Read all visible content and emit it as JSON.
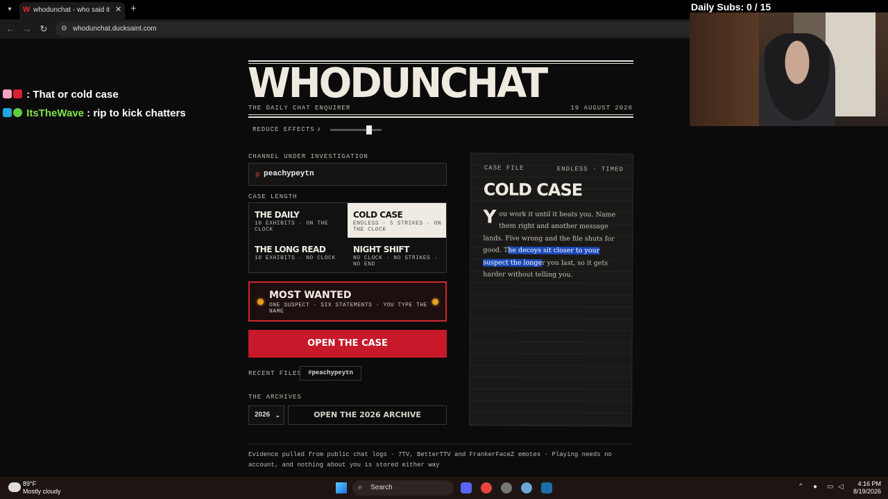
{
  "browser": {
    "tab_title": "whodunchat - who said it in your chat",
    "tab_favicon": "W",
    "url": "whodunchat.ducksaint.com"
  },
  "overlay": {
    "daily_subs": "Daily Subs: 0 / 15",
    "chat": [
      {
        "user": "",
        "user_color": "#8a2be2",
        "message": ": That or cold case"
      },
      {
        "user": "ItsTheWave",
        "user_color": "#7fe34a",
        "message": ": rip to kick chatters"
      }
    ]
  },
  "masthead": {
    "logo": "WHODUNCHAT",
    "tagline": "THE DAILY CHAT ENQUIRER",
    "date": "19 AUGUST 2026",
    "reduce_effects": "REDUCE EFFECTS",
    "music_note": "♪"
  },
  "channel": {
    "label": "CHANNEL UNDER INVESTIGATION",
    "hash": "#",
    "value": "peachypeytn"
  },
  "case_length": {
    "label": "CASE LENGTH",
    "options": [
      {
        "title": "THE DAILY",
        "desc": "10 EXHIBITS · ON THE CLOCK"
      },
      {
        "title": "COLD CASE",
        "desc": "ENDLESS · 5 STRIKES · ON THE CLOCK"
      },
      {
        "title": "THE LONG READ",
        "desc": "10 EXHIBITS · NO CLOCK"
      },
      {
        "title": "NIGHT SHIFT",
        "desc": "NO CLOCK · NO STRIKES · NO END"
      }
    ]
  },
  "most_wanted": {
    "title": "MOST WANTED",
    "desc": "ONE SUSPECT · SIX STATEMENTS · YOU TYPE THE NAME"
  },
  "open_case": "OPEN THE CASE",
  "recent": {
    "label": "RECENT FILES",
    "chip": "#peachypeytn"
  },
  "archives": {
    "label": "THE ARCHIVES",
    "year": "2026",
    "button": "OPEN THE 2026 ARCHIVE"
  },
  "footer": {
    "line1": "Evidence pulled from public chat logs · 7TV, BetterTTV and FrankerFaceZ emotes · Playing needs no",
    "line2": "account, and nothing about you is stored either way"
  },
  "case_file": {
    "header": "CASE FILE",
    "mode": "ENDLESS · TIMED",
    "title": "COLD CASE",
    "drop_cap": "Y",
    "body_pre": "ou work it until it beats you. Name them right and another message lands. Five wrong and the file shuts for good. T",
    "body_highlight": "he decoys sit closer to your suspect the longe",
    "body_post": "r you last, so it gets harder without telling you."
  },
  "taskbar": {
    "temperature": "89°F",
    "condition": "Mostly cloudy",
    "search": "Search",
    "time": "4:16 PM",
    "date": "8/19/2026"
  },
  "colors": {
    "accent_red": "#c8192a",
    "highlight_blue": "#1d49b8",
    "bulb_amber": "#e8a020"
  }
}
